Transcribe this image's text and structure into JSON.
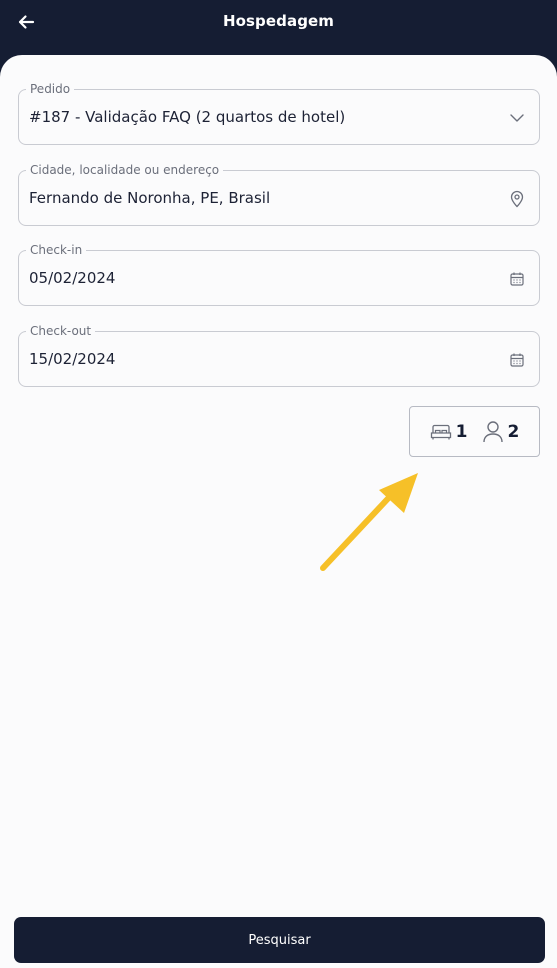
{
  "header": {
    "title": "Hospedagem",
    "back_icon": "arrow-left-icon"
  },
  "form": {
    "order": {
      "label": "Pedido",
      "value": "#187 - Validação FAQ (2 quartos de hotel)",
      "icon": "chevron-down-icon"
    },
    "city": {
      "label": "Cidade, localidade ou endereço",
      "value": "Fernando de Noronha, PE, Brasil",
      "icon": "map-pin-icon"
    },
    "checkin": {
      "label": "Check-in",
      "value": "05/02/2024",
      "icon": "calendar-icon"
    },
    "checkout": {
      "label": "Check-out",
      "value": "15/02/2024",
      "icon": "calendar-icon"
    }
  },
  "guests": {
    "rooms": "1",
    "people": "2",
    "rooms_icon": "bed-icon",
    "people_icon": "person-icon"
  },
  "annotation": {
    "color": "#f6c028",
    "icon": "pointer-arrow"
  },
  "footer": {
    "search_label": "Pesquisar"
  },
  "colors": {
    "primary": "#151d33",
    "background": "#fbfbfc",
    "border": "#c9cbd2"
  }
}
